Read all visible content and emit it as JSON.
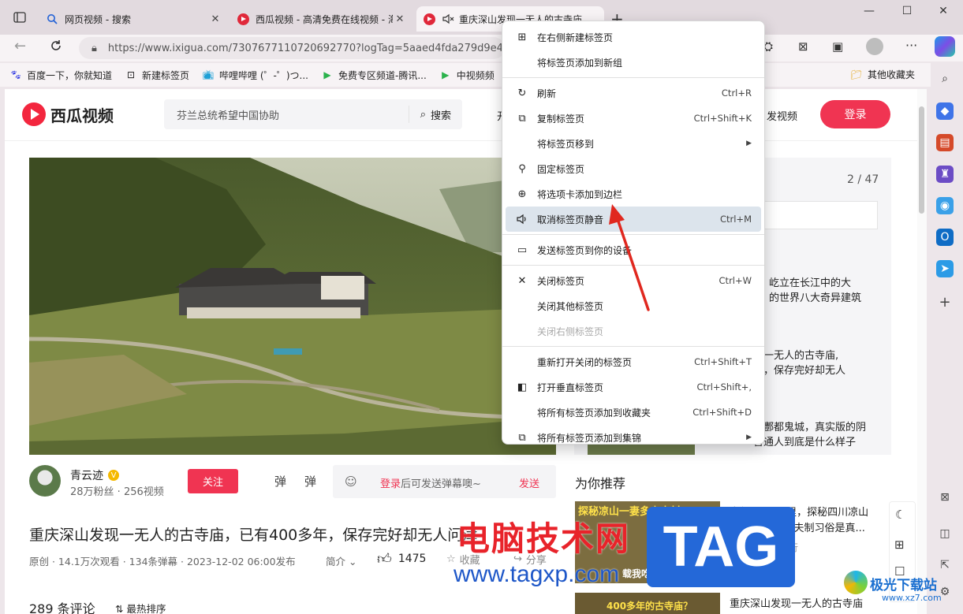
{
  "tabs": [
    {
      "title": "网页视频 - 搜索",
      "icon": "search-icon"
    },
    {
      "title": "西瓜视频 - 高清免费在线视频 - 海",
      "icon": "xigua-icon"
    },
    {
      "title": "重庆深山发现一无人的古寺庙",
      "icon": "xigua-icon"
    }
  ],
  "new_tab_symbol": "+",
  "window": {
    "min": "—",
    "max": "☐",
    "close": "✕"
  },
  "address": {
    "url": "https://www.ixigua.com/7307677110720692770?logTag=5aaed4fda279d9e48..."
  },
  "bookmarks": [
    {
      "label": "百度一下，你就知道"
    },
    {
      "label": "新建标签页"
    },
    {
      "label": "哔哩哔哩 (゜-゜)つ..."
    },
    {
      "label": "免费专区频道-腾讯..."
    },
    {
      "label": "中视频频"
    }
  ],
  "other_bookmarks": "其他收藏夹",
  "site": {
    "logo_text": "西瓜视频",
    "search_placeholder": "芬兰总统希望中国协助",
    "search_button": "搜索",
    "publish": "发视频",
    "login": "登录",
    "header_partial": "开"
  },
  "panel": {
    "counter": "2 / 47",
    "items": [
      {
        "l1": "屹立在长江中的大",
        "l2": "的世界八大奇异建筑"
      },
      {
        "l1": "现一无人的古寺庙,",
        "l2": "年，保存完好却无人"
      },
      {
        "l1": "比酆都鬼城，真实版的阴",
        "l2": "普通人到底是什么样子"
      }
    ]
  },
  "author": {
    "name": "青云迹",
    "stats": "28万粉丝 · 256视频",
    "follow": "关注",
    "danmu_login": "登录",
    "danmu_hint": "后可发送弹幕噢~",
    "send": "发送",
    "danmu_icon_label": "弹"
  },
  "video": {
    "title": "重庆深山发现一无人的古寺庙，已有400多年，保存完好却无人问津",
    "meta": "原创 · 14.1万次观看 · 134条弹幕 · 2023-12-02 06:00发布",
    "intro": "简介",
    "likes": "1475",
    "collect": "收藏",
    "share": "分享"
  },
  "comments": {
    "count": "289 条评论",
    "sort": "最热排序"
  },
  "recommend": {
    "heading": "为你推荐",
    "items": [
      {
        "title1": "自驾2000公里，探秘四川凉山",
        "title2": "古村，... 妻多夫制习俗是真...",
        "sub1": "行",
        "sub2": "收",
        "thumb_text": "探秘凉山一妻多夫古村",
        "thumb_bottom": "载我吃羊鲜板"
      },
      {
        "title1": "重庆深山发现一无人的古寺庙",
        "thumb_text": "400多年的古寺庙？"
      }
    ]
  },
  "context_menu": {
    "items": [
      {
        "label": "在右侧新建标签页",
        "shortcut": "",
        "icon": "new-tab-icon"
      },
      {
        "label": "将标签页添加到新组",
        "shortcut": "",
        "icon": ""
      },
      {
        "label": "刷新",
        "shortcut": "Ctrl+R",
        "icon": "refresh-icon"
      },
      {
        "label": "复制标签页",
        "shortcut": "Ctrl+Shift+K",
        "icon": "duplicate-icon"
      },
      {
        "label": "将标签页移到",
        "shortcut": "",
        "icon": ""
      },
      {
        "label": "固定标签页",
        "shortcut": "",
        "icon": "pin-icon"
      },
      {
        "label": "将选项卡添加到边栏",
        "shortcut": "",
        "icon": "sidebar-add-icon"
      },
      {
        "label": "取消标签页静音",
        "shortcut": "Ctrl+M",
        "icon": "speaker-icon"
      },
      {
        "label": "发送标签页到你的设备",
        "shortcut": "",
        "icon": "device-icon"
      },
      {
        "label": "关闭标签页",
        "shortcut": "Ctrl+W",
        "icon": "close-icon"
      },
      {
        "label": "关闭其他标签页",
        "shortcut": "",
        "icon": ""
      },
      {
        "label": "关闭右侧标签页",
        "shortcut": "",
        "icon": ""
      },
      {
        "label": "重新打开关闭的标签页",
        "shortcut": "Ctrl+Shift+T",
        "icon": ""
      },
      {
        "label": "打开垂直标签页",
        "shortcut": "Ctrl+Shift+,",
        "icon": "vertical-tabs-icon"
      },
      {
        "label": "将所有标签页添加到收藏夹",
        "shortcut": "Ctrl+Shift+D",
        "icon": ""
      },
      {
        "label": "将所有标签页添加到集锦",
        "shortcut": "",
        "icon": "collections-icon"
      }
    ]
  },
  "watermark": {
    "site_cn": "电脑技术网",
    "url": "www.tagxp.com",
    "tag": "TAG",
    "corner": "极光下载站",
    "corner_url": "www.xz7.com"
  },
  "colors": {
    "accent": "#f03452",
    "highlight": "#dce4ec",
    "arrow": "#e0281f"
  }
}
